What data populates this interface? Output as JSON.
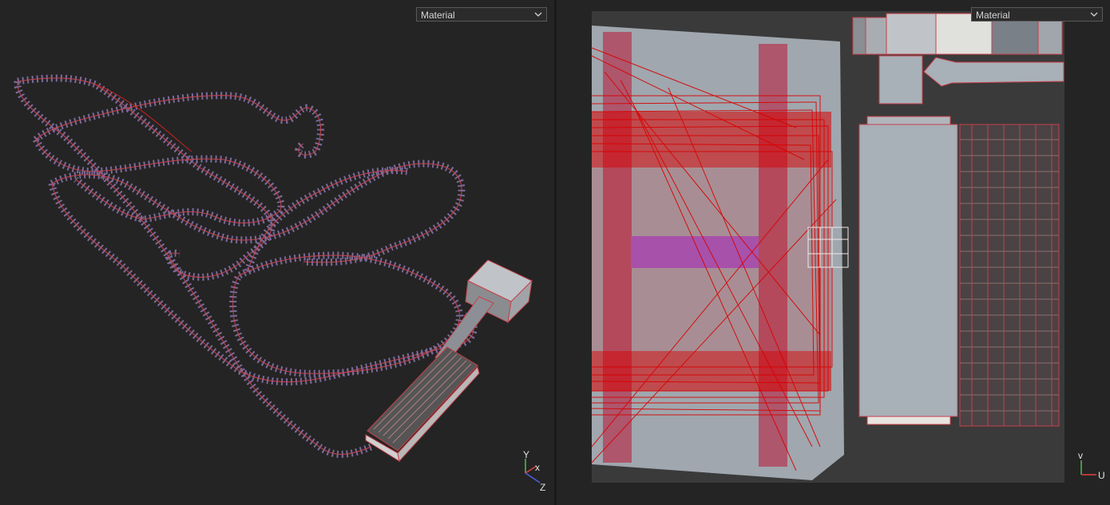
{
  "left_viewport": {
    "shading_dropdown": {
      "selected": "Material"
    },
    "gizmo": {
      "y": "Y",
      "x": "x",
      "z": "Z"
    }
  },
  "right_viewport": {
    "shading_dropdown": {
      "selected": "Material"
    },
    "gizmo": {
      "v": "v",
      "u": "U"
    }
  },
  "colors": {
    "background": "#242424",
    "wire": "#c8404a",
    "uv_overlap": "#d80000",
    "uv_mesh": "#a8b0b8",
    "accent_purple": "#a060c8",
    "axis_x": "#e04040",
    "axis_y": "#50c050",
    "axis_z": "#5060e0"
  },
  "icons": [
    "chevron-down-icon",
    "axis-gizmo-icon",
    "uv-axis-icon"
  ]
}
